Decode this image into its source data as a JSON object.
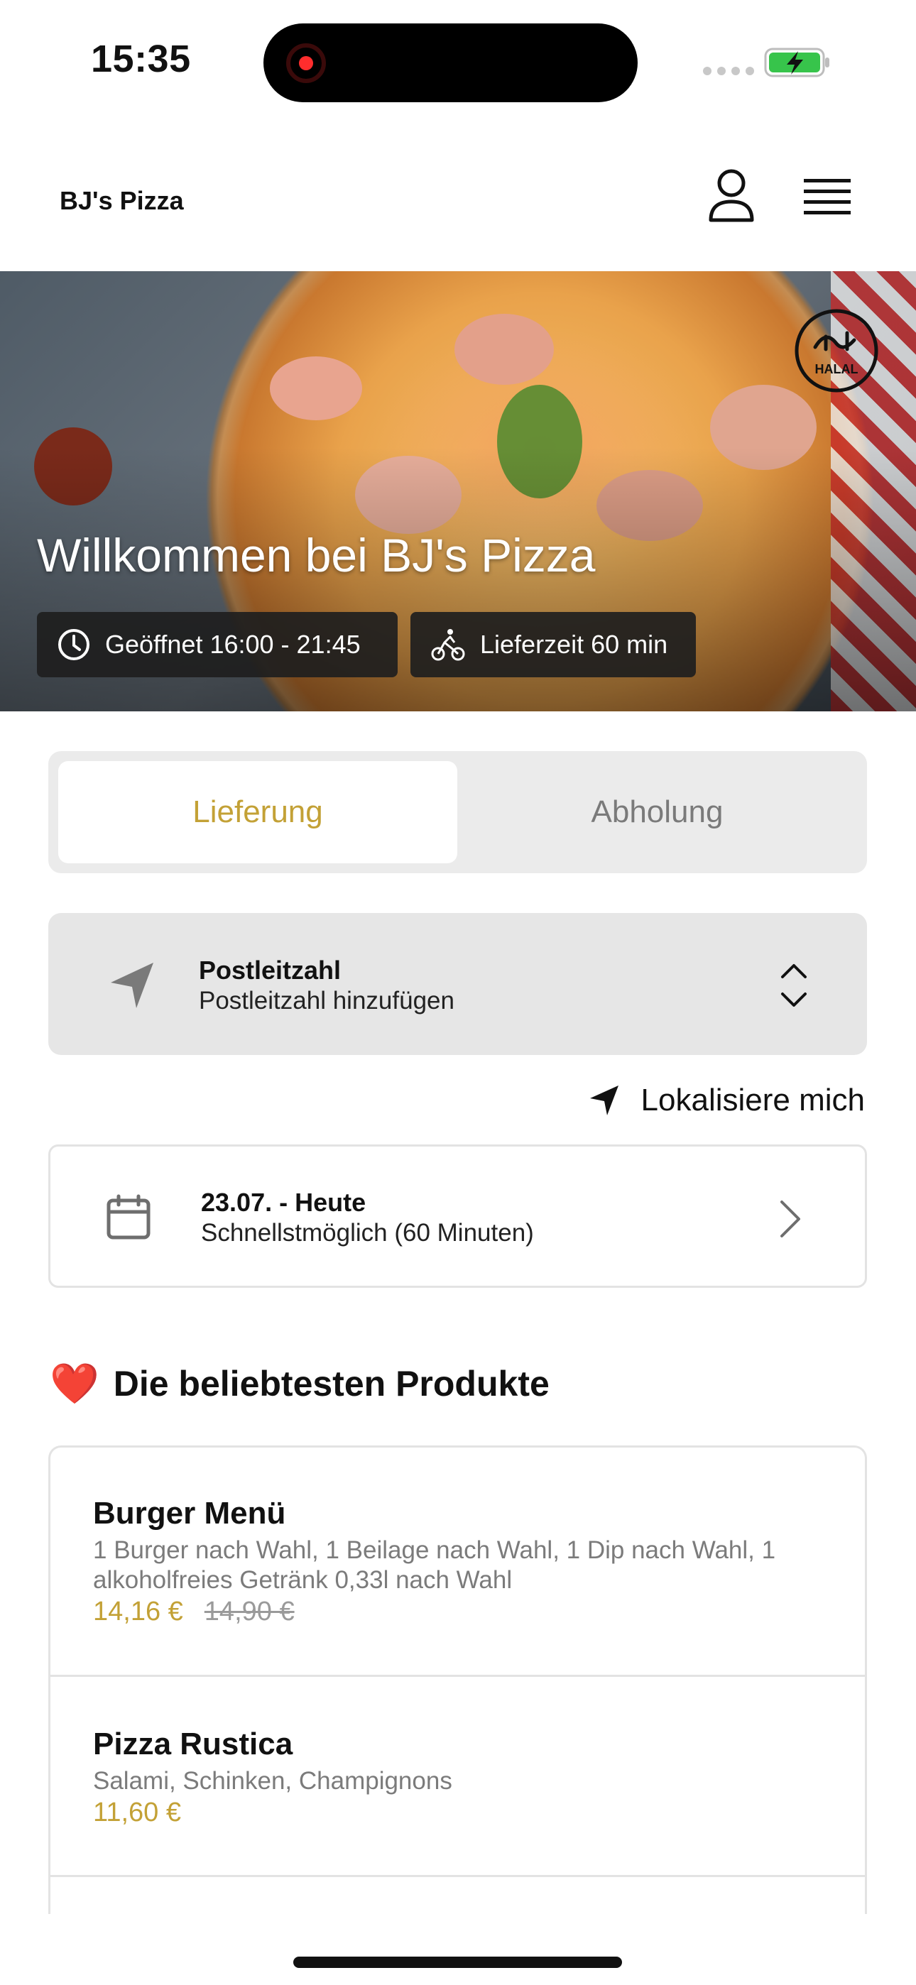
{
  "status_bar": {
    "time": "15:35"
  },
  "header": {
    "brand": "BJ's Pizza",
    "icons": {
      "profile": "user-icon",
      "menu": "hamburger-menu-icon"
    }
  },
  "hero": {
    "title": "Willkommen bei BJ's Pizza",
    "badge_text": "HALAL",
    "hours_label": "Geöffnet 16:00 - 21:45",
    "delivery_label": "Lieferzeit 60 min"
  },
  "order_mode": {
    "options": [
      "Lieferung",
      "Abholung"
    ],
    "selected": "Lieferung",
    "accent_color": "#c3a136"
  },
  "postal_code": {
    "label": "Postleitzahl",
    "placeholder": "Postleitzahl hinzufügen"
  },
  "locate_label": "Lokalisiere mich",
  "schedule": {
    "date_label": "23.07. - Heute",
    "time_label": "Schnellstmöglich (60 Minuten)"
  },
  "popular": {
    "title": "Die beliebtesten Produkte",
    "emoji": "❤️",
    "products": [
      {
        "name": "Burger Menü",
        "description": "1 Burger nach Wahl, 1 Beilage nach Wahl, 1 Dip nach Wahl, 1 alkoholfreies Getränk 0,33l nach Wahl",
        "price": "14,16 €",
        "old_price": "14,90 €"
      },
      {
        "name": "Pizza Rustica",
        "description": "Salami, Schinken, Champignons",
        "price": "11,60 €"
      }
    ]
  }
}
